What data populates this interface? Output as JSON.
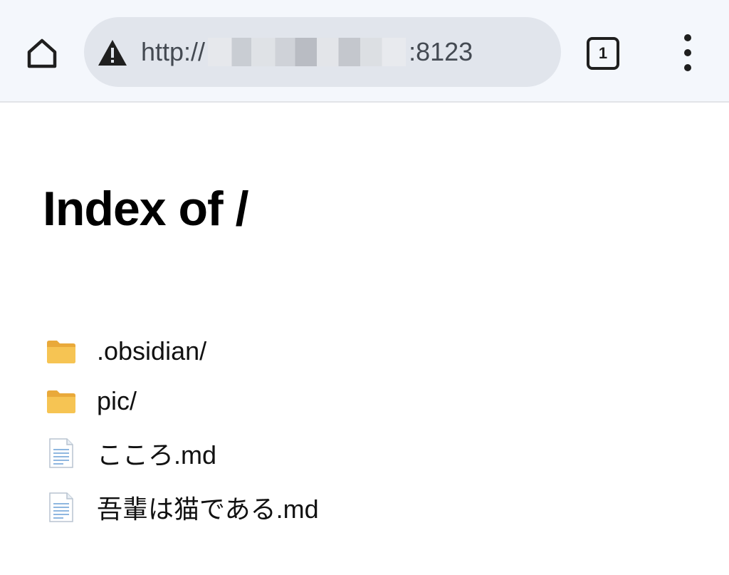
{
  "browser": {
    "url_scheme": "http://",
    "url_port": ":8123",
    "tab_count": "1"
  },
  "page": {
    "title": "Index of /"
  },
  "entries": [
    {
      "name": ".obsidian/",
      "type": "folder"
    },
    {
      "name": "pic/",
      "type": "folder"
    },
    {
      "name": "こころ.md",
      "type": "file"
    },
    {
      "name": "吾輩は猫である.md",
      "type": "file"
    }
  ],
  "icons": {
    "home": "home-icon",
    "warning": "warning-icon",
    "tabs": "tab-switcher-icon",
    "menu": "more-vert-icon",
    "folder": "folder-icon",
    "file": "document-icon"
  },
  "colors": {
    "toolbar_bg": "#f4f7fc",
    "omnibox_bg": "#e1e5ec",
    "folder": "#f4b942",
    "file_lines": "#8fb7e0"
  }
}
